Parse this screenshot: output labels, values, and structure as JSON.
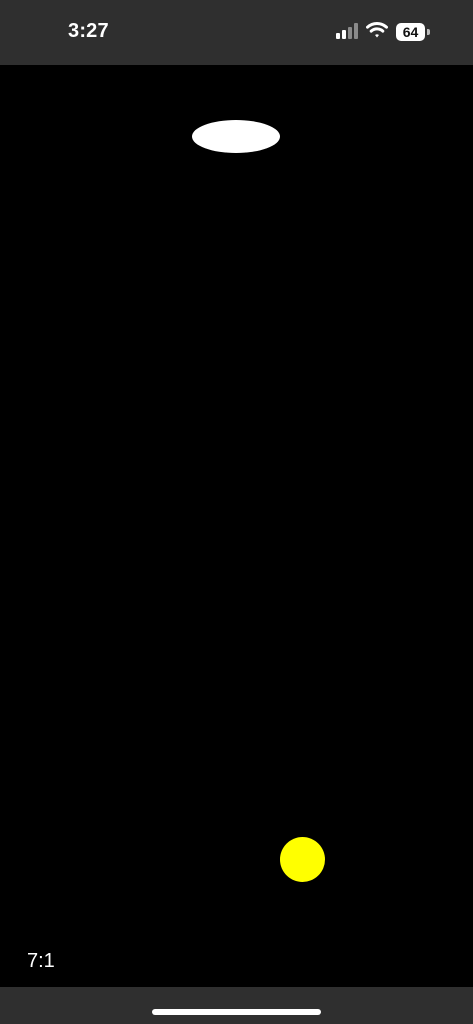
{
  "status_bar": {
    "time": "3:27",
    "battery_level": "64",
    "signal_icon": "cellular-signal-icon",
    "wifi_icon": "wifi-icon",
    "battery_icon": "battery-icon"
  },
  "game": {
    "score": "7:1",
    "paddle_color": "#FFFFFF",
    "ball_color": "#FFFF00",
    "background_color": "#000000"
  },
  "system": {
    "status_bar_color": "#2F2F2F"
  }
}
